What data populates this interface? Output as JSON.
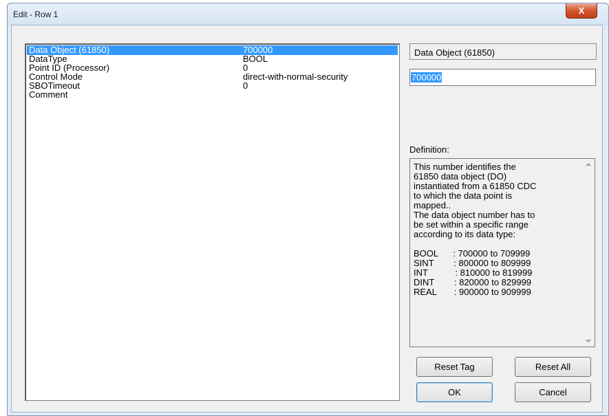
{
  "window": {
    "title": "Edit - Row 1",
    "close_glyph": "X"
  },
  "properties": [
    {
      "name": "Data Object (61850)",
      "value": "700000",
      "selected": true
    },
    {
      "name": "DataType",
      "value": "BOOL"
    },
    {
      "name": "Point ID (Processor)",
      "value": "0"
    },
    {
      "name": "Control Mode",
      "value": "direct-with-normal-security"
    },
    {
      "name": "SBOTimeout",
      "value": "0"
    },
    {
      "name": "Comment",
      "value": ""
    }
  ],
  "selected_field": {
    "name": "Data Object (61850)",
    "value": "700000"
  },
  "definition": {
    "label": "Definition:",
    "text": "This number identifies the\n61850 data object (DO)\ninstantiated from a 61850 CDC\nto which the data point is\nmapped..\nThe data object number has to\nbe set within a specific range\naccording to its data type:\n\nBOOL      : 700000 to 709999\nSINT        : 800000 to 809999\nINT           : 810000 to 819999\nDINT        : 820000 to 829999\nREAL       : 900000 to 909999"
  },
  "buttons": {
    "reset_tag": "Reset Tag",
    "reset_all": "Reset All",
    "ok": "OK",
    "cancel": "Cancel"
  },
  "colors": {
    "selection": "#3399ff",
    "close_button": "#c84a26"
  }
}
